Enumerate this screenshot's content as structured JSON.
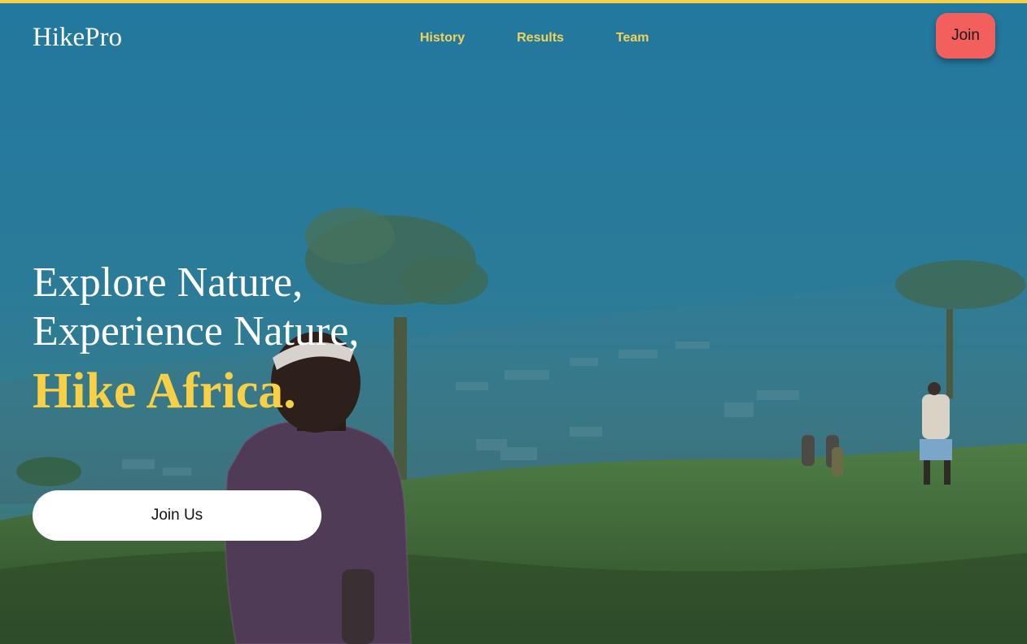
{
  "brand": {
    "logo": "HikePro"
  },
  "nav": {
    "items": [
      "History",
      "Results",
      "Team"
    ]
  },
  "header": {
    "join_label": "Join"
  },
  "hero": {
    "line1": "Explore Nature,",
    "line2": "Experience Nature,",
    "accent": "Hike Africa.",
    "cta_label": "Join Us"
  },
  "colors": {
    "accent_yellow": "#f7d046",
    "nav_text": "#f2d35a",
    "join_button": "#f25f5c",
    "overlay_blue": "#1f6f92"
  }
}
